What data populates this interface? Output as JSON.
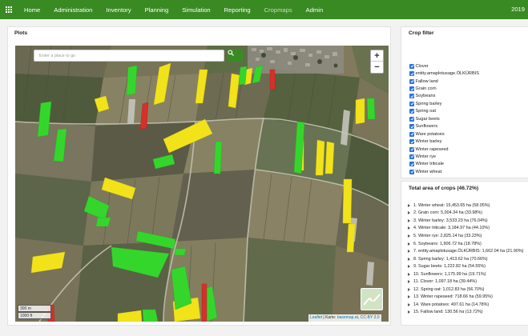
{
  "nav": {
    "items": [
      "Home",
      "Administration",
      "Inventory",
      "Planning",
      "Simulation",
      "Reporting",
      "Cropmaps",
      "Admin"
    ],
    "active_index": 6,
    "year": "2019"
  },
  "plots": {
    "title": "Plots",
    "search_placeholder": "Enter a place to go",
    "zoom_in": "+",
    "zoom_out": "−",
    "scale_metric": "300 m",
    "scale_imperial": "1000 ft",
    "attribution": {
      "leaflet": "Leaflet",
      "sep1": " | Karte: ",
      "basemap": "basemap.at",
      "sep2": ", ",
      "license": "CC-BY 3.0"
    }
  },
  "crop_filter": {
    "title": "Crop filter",
    "items": [
      {
        "label": "Clover",
        "checked": true
      },
      {
        "label": "entity.amaplotusage.ÖLKÜRBIS",
        "checked": true
      },
      {
        "label": "Fallow land",
        "checked": true
      },
      {
        "label": "Grain corn",
        "checked": true
      },
      {
        "label": "Soybeans",
        "checked": true
      },
      {
        "label": "Spring barley",
        "checked": true
      },
      {
        "label": "Spring oat",
        "checked": true
      },
      {
        "label": "Sugar beets",
        "checked": true
      },
      {
        "label": "Sunflowers",
        "checked": true
      },
      {
        "label": "Ware potatoes",
        "checked": true
      },
      {
        "label": "Winter barley",
        "checked": true
      },
      {
        "label": "Winter rapeseed",
        "checked": true
      },
      {
        "label": "Winter rye",
        "checked": true
      },
      {
        "label": "Winter triticale",
        "checked": true
      },
      {
        "label": "Winter wheat",
        "checked": true
      }
    ]
  },
  "total_area": {
    "title": "Total area of crops (46.72%)",
    "items": [
      "1. Winter wheat: 15,453.65 ha (58.05%)",
      "2. Grain corn: 5,004.34 ha (33.98%)",
      "3. Winter barley: 3,533.23 ha (76.04%)",
      "4. Winter triticale: 3,184.97 ha (44.10%)",
      "5. Winter rye: 2,825.14 ha (33.23%)",
      "6. Soybeans: 1,906.72 ha (18.78%)",
      "7. entity.amaplotusage.ÖLKÜRBIS: 1,662.04 ha (21.90%)",
      "8. Spring barley: 1,413.62 ha (70.66%)",
      "9. Sugar beets: 1,222.82 ha (54.55%)",
      "10. Sunflowers: 1,175.99 ha (19.71%)",
      "11. Clover: 1,097.18 ha (39.44%)",
      "12. Spring oat: 1,012.83 ha (56.70%)",
      "13. Winter rapeseed: 718.66 ha (59.95%)",
      "14. Ware potatoes: 497.61 ha (14.78%)",
      "15. Fallow land: 130.56 ha (13.72%)"
    ]
  },
  "colors": {
    "navbar": "#3a8a24",
    "crop_yellow": "#f2e21a",
    "crop_green": "#35d62c",
    "crop_red": "#d5302a",
    "checkbox": "#2b73d9"
  }
}
